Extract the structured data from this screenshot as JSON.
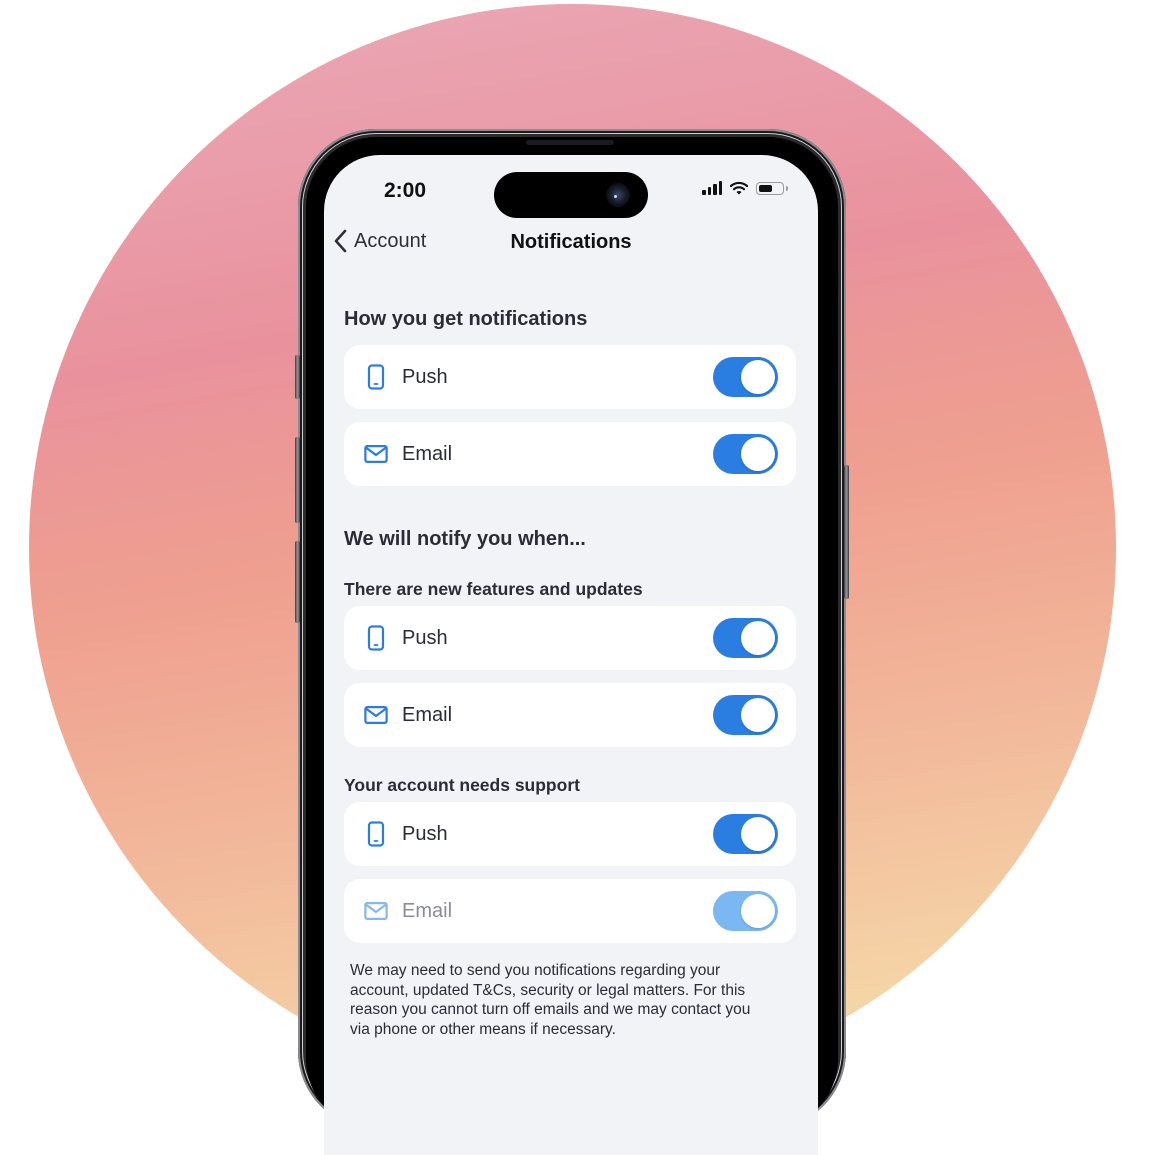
{
  "colors": {
    "accent": "#2a7de1",
    "accent_disabled": "#7ab7f3",
    "screen_bg": "#f2f3f7",
    "card_bg": "#ffffff",
    "text_primary": "#2a2c36"
  },
  "status_bar": {
    "time": "2:00",
    "icons": [
      "cellular-signal-icon",
      "wifi-icon",
      "battery-icon"
    ]
  },
  "nav": {
    "back_label": "Account",
    "back_icon": "chevron-left-icon",
    "title": "Notifications"
  },
  "channels_section": {
    "title": "How you get notifications",
    "rows": [
      {
        "icon": "phone-icon",
        "label": "Push",
        "enabled": true,
        "disabled": false
      },
      {
        "icon": "mail-icon",
        "label": "Email",
        "enabled": true,
        "disabled": false
      }
    ]
  },
  "notify_section": {
    "title": "We will notify you when...",
    "groups": [
      {
        "title": "There are new features and updates",
        "rows": [
          {
            "icon": "phone-icon",
            "label": "Push",
            "enabled": true,
            "disabled": false
          },
          {
            "icon": "mail-icon",
            "label": "Email",
            "enabled": true,
            "disabled": false
          }
        ]
      },
      {
        "title": "Your account needs support",
        "rows": [
          {
            "icon": "phone-icon",
            "label": "Push",
            "enabled": true,
            "disabled": false
          },
          {
            "icon": "mail-icon",
            "label": "Email",
            "enabled": true,
            "disabled": true
          }
        ]
      }
    ]
  },
  "footnote": "We may need to send you notifications regarding your account, updated T&Cs, security or legal matters. For this reason you cannot turn off emails and we may contact you via phone or other means if necessary."
}
